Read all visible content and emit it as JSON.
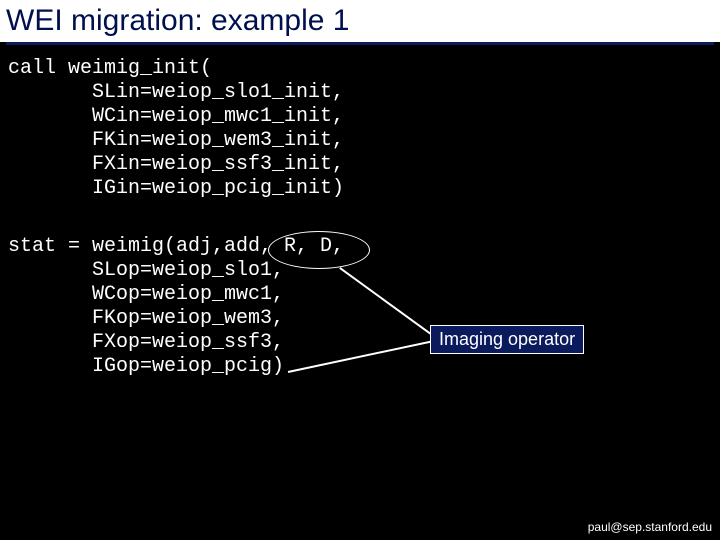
{
  "title": "WEI migration: example 1",
  "code_block1": "call weimig_init(\n       SLin=weiop_slo1_init,\n       WCin=weiop_mwc1_init,\n       FKin=weiop_wem3_init,\n       FXin=weiop_ssf3_init,\n       IGin=weiop_pcig_init)",
  "code_block2": "stat = weimig(adj,add, R, D,\n       SLop=weiop_slo1,\n       WCop=weiop_mwc1,\n       FKop=weiop_wem3,\n       FXop=weiop_ssf3,\n       IGop=weiop_pcig)",
  "callout_label": "Imaging operator",
  "footer": "paul@sep.stanford.edu"
}
